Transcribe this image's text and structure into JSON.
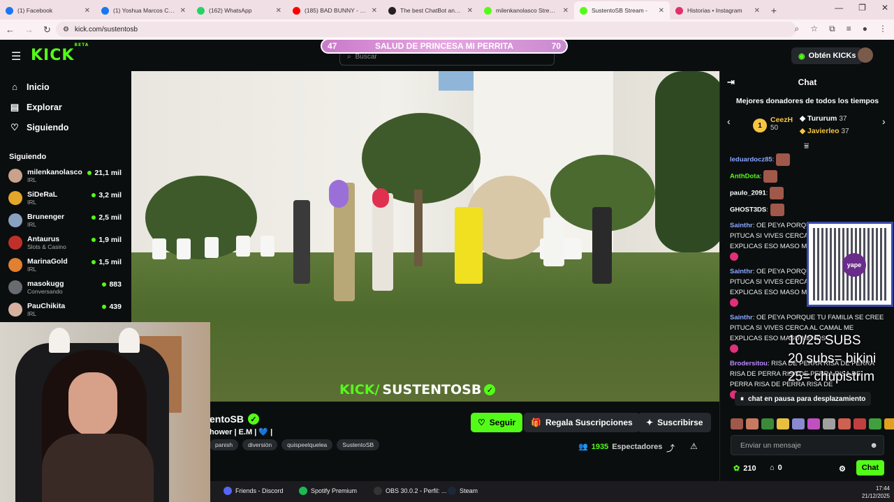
{
  "browser": {
    "tabs": [
      {
        "title": "(1) Facebook",
        "color": "#1877f2"
      },
      {
        "title": "(1) Yoshua Marcos CA | Fa",
        "color": "#1877f2"
      },
      {
        "title": "(162) WhatsApp",
        "color": "#25d366"
      },
      {
        "title": "(185) BAD BUNNY - CALL",
        "color": "#ff0000"
      },
      {
        "title": "The best ChatBot and Wi",
        "color": "#222222"
      },
      {
        "title": "milenkanolasco Stream -",
        "color": "#53fc18"
      },
      {
        "title": "SustentoSB Stream -",
        "color": "#53fc18",
        "active": true
      },
      {
        "title": "Historias • Instagram",
        "color": "#e1306c"
      }
    ],
    "url": "kick.com/sustentosb"
  },
  "header": {
    "logo": "KICK",
    "logo_beta": "BETA",
    "search_placeholder": "Buscar",
    "kicks_button": "Obtén KICKs",
    "accent": "#53fc18"
  },
  "banner": {
    "left": "47",
    "text": "SALUD DE PRINCESA MI PERRITA",
    "right": "70"
  },
  "sidebar": {
    "nav": [
      {
        "label": "Inicio",
        "icon": "home-icon",
        "glyph": "⌂"
      },
      {
        "label": "Explorar",
        "icon": "browse-icon",
        "glyph": "▤"
      },
      {
        "label": "Siguiendo",
        "icon": "heart-icon",
        "glyph": "♡"
      }
    ],
    "following_title": "Siguiendo",
    "following": [
      {
        "name": "milenkanolasco",
        "category": "IRL",
        "viewers": "21,1 mil",
        "color": "#c9a28a"
      },
      {
        "name": "SiDeRaL",
        "category": "IRL",
        "viewers": "3,2 mil",
        "color": "#e3a52a"
      },
      {
        "name": "Brunenger",
        "category": "IRL",
        "viewers": "2,5 mil",
        "color": "#8aa0c0"
      },
      {
        "name": "Antaurus",
        "category": "Slots & Casino",
        "viewers": "1,9 mil",
        "color": "#c0302a"
      },
      {
        "name": "MarinaGold",
        "category": "IRL",
        "viewers": "1,5 mil",
        "color": "#e08030"
      },
      {
        "name": "masokugg",
        "category": "Conversando",
        "viewers": "883",
        "color": "#6a6a70"
      },
      {
        "name": "PauChikita",
        "category": "IRL",
        "viewers": "439",
        "color": "#d8b0a0"
      }
    ]
  },
  "video": {
    "overlay_prefix": "KICK/",
    "overlay_name": "SUSTENTOSB"
  },
  "channel": {
    "name": "entoSB",
    "title": "hower | E.M | 💙 |",
    "tags": [
      "panish",
      "diversión",
      "quispeelquelea",
      "SustentoSB"
    ],
    "follow_label": "Seguir",
    "gift_label": "Regala Suscripciones",
    "subscribe_label": "Suscribirse",
    "viewers_count": "1935",
    "viewers_label": "Espectadores"
  },
  "chat": {
    "title": "Chat",
    "donors_title": "Mejores donadores de todos los tiempos",
    "donors": [
      {
        "name": "CeezH",
        "amount": "50",
        "rank": "1",
        "color": "#f5c542"
      },
      {
        "name": "Tururum",
        "amount": "37",
        "color": "#ffffff"
      },
      {
        "name": "Javierleo",
        "amount": "37",
        "color": "#f5c542"
      }
    ],
    "messages": [
      {
        "user": "leduardocz85",
        "color": "#8aa8ff",
        "text": ""
      },
      {
        "user": "AnthDota",
        "color": "#53fc18",
        "text": ""
      },
      {
        "user": "paulo_2091",
        "color": "#ffffff",
        "text": ""
      },
      {
        "user": "GHOST3DS",
        "color": "#ffffff",
        "text": ""
      },
      {
        "user": "Sainthr",
        "color": "#8aa8ff",
        "text": "OE PEYA PORQUE TU FAMILIA SE CREE PITUCA SI VIVES CERCA AL CAMAL ME EXPLICAS ESO MASO M"
      },
      {
        "user": "Sainthr",
        "color": "#8aa8ff",
        "text": "OE PEYA PORQUE TU FAMILIA SE CREE PITUCA SI VIVES CERCA AL CAMAL ME EXPLICAS ESO MASO M"
      },
      {
        "user": "Sainthr",
        "color": "#8aa8ff",
        "text": "OE PEYA PORQUE TU FAMILIA SE CREE PITUCA SI VIVES CERCA AL CAMAL ME EXPLICAS ESO MASO MENOS"
      },
      {
        "user": "Brodersitou",
        "color": "#b88aff",
        "text": "RISA DE PERRA RISA DE PERRA RISA DE PERRA RISA DE PERRA RISA DE PERRA RISA DE PERRA RISA DE"
      }
    ],
    "qr_label": "yape",
    "subs_overlay": [
      "10/25 SUBS",
      "20 subs= bikini",
      "25= chupistrim"
    ],
    "paused_label": "chat en pausa para desplazamiento",
    "input_placeholder": "Enviar un mensaje",
    "points": "210",
    "unknown_count": "0",
    "send_label": "Chat"
  },
  "taskbar": {
    "items": [
      {
        "label": "Friends - Discord",
        "color": "#5865f2"
      },
      {
        "label": "Spotify Premium",
        "color": "#1db954"
      },
      {
        "label": "OBS 30.0.2 - Perfil: ...",
        "color": "#333333"
      },
      {
        "label": "Steam",
        "color": "#1b2838"
      }
    ],
    "time": "17:44",
    "date": "21/12/2025"
  }
}
